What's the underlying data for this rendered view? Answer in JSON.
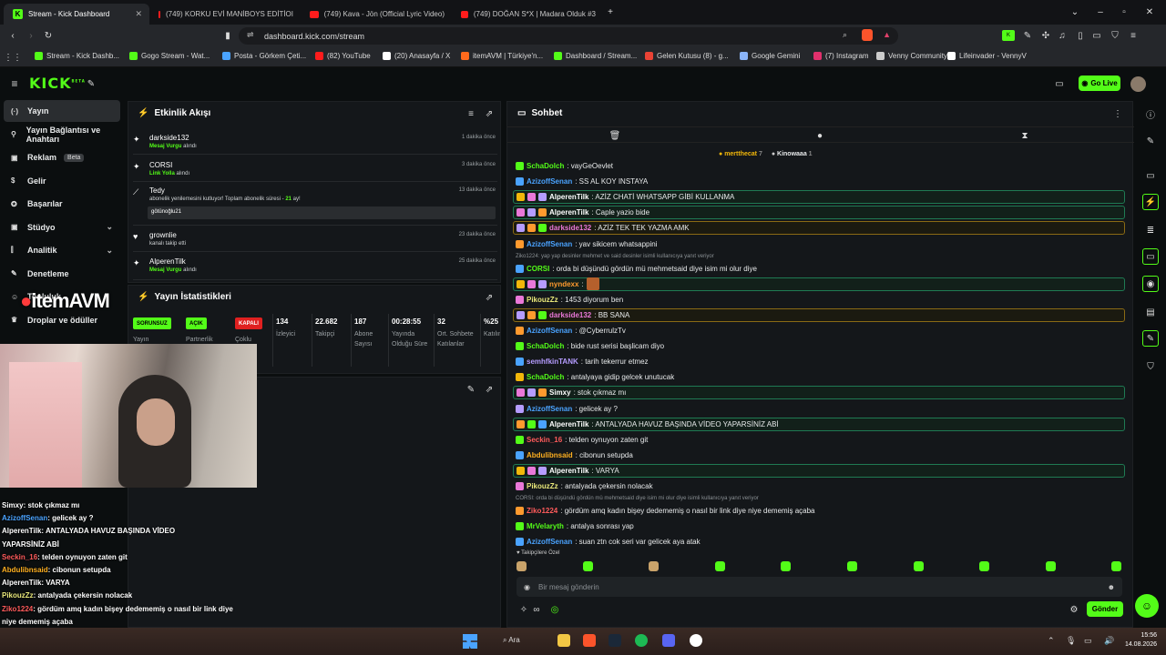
{
  "browser": {
    "tabs": [
      {
        "label": "Stream - Kick Dashboard",
        "active": true
      },
      {
        "label": "(749) KORKU EVİ MANİBOYS EDİTİOI"
      },
      {
        "label": "(749) Kava - Jön (Official Lyric Video)"
      },
      {
        "label": "(749) DOĞAN S*X | Madara Olduk #3"
      }
    ],
    "url": "dashboard.kick.com/stream",
    "bookmarks": [
      "Stream - Kick Dashb...",
      "Gogo Stream - Wat...",
      "Posta - Görkem Çeti...",
      "(82) YouTube",
      "(20) Anasayfa / X",
      "itemAVM | Türkiye'n...",
      "Dashboard / Stream...",
      "Gelen Kutusu (8) - g...",
      "Google Gemini",
      "(7) Instagram",
      "Venny Community",
      "Lifeinvader - VennyV"
    ]
  },
  "header": {
    "logo": "KICK",
    "logo_sup": "BETA",
    "go_live": "Go Live"
  },
  "sidebar": {
    "items": [
      {
        "label": "Yayın"
      },
      {
        "label": "Yayın Bağlantısı ve Anahtarı"
      },
      {
        "label": "Reklam",
        "badge": "Beta"
      },
      {
        "label": "Gelir"
      },
      {
        "label": "Başarılar"
      },
      {
        "label": "Stüdyo"
      },
      {
        "label": "Analitik"
      },
      {
        "label": "Denetleme"
      },
      {
        "label": "Topluluk"
      },
      {
        "label": "Droplar ve ödüller"
      }
    ]
  },
  "activity": {
    "title": "Etkinlik Akışı",
    "events": [
      {
        "name": "darkside132",
        "action": "Mesaj Vurgu",
        "suffix": "alındı",
        "time": "1 dakika önce"
      },
      {
        "name": "CORSI",
        "action": "Link Yolla",
        "suffix": "alındı",
        "time": "3 dakika önce"
      },
      {
        "name": "Tedy",
        "text": "abonelik yenilemesini kutluyor! Toplam abonelik süresi -",
        "months": "21",
        "months_suffix": "ay!",
        "message": "götünoğlu21",
        "time": "13 dakika önce"
      },
      {
        "name": "grownlie",
        "text": "kanalı takip etti",
        "time": "23 dakika önce"
      },
      {
        "name": "AlperenTilk",
        "action": "Mesaj Vurgu",
        "suffix": "alındı",
        "time": "25 dakika önce"
      }
    ]
  },
  "stats": {
    "title": "Yayın İstatistikleri",
    "pills": [
      "SORUNSUZ",
      "AÇIK",
      "KAPALI"
    ],
    "pill_labels": [
      "Yayın",
      "Partnerlik",
      "Çoklu"
    ],
    "items": [
      {
        "value": "134",
        "label": "İzleyici"
      },
      {
        "value": "22.682",
        "label": "Takipçi"
      },
      {
        "value": "187",
        "label": "Abone Sayısı"
      },
      {
        "value": "00:28:55",
        "label": "Yayında Olduğu Süre"
      },
      {
        "value": "32",
        "label": "Ort. Sohbete Katılanlar"
      },
      {
        "value": "%25",
        "label": "Katılım"
      }
    ]
  },
  "webcam_overlay": {
    "brand": "itemAVM",
    "lines": [
      {
        "user": "Simxy",
        "text": ": stok çıkmaz mı",
        "color": "#ffffff"
      },
      {
        "user": "AzizoffSenan",
        "text": ": gelicek ay ?",
        "color": "#4aa3ff"
      },
      {
        "user": "AlperenTilk",
        "text": ": ANTALYADA HAVUZ BAŞINDA VİDEO",
        "color": "#ffffff"
      },
      {
        "user": "",
        "text": "YAPARSİNİZ ABİ",
        "color": "#ffffff"
      },
      {
        "user": "Seckin_16",
        "text": ": telden oynuyon zaten git",
        "color": "#ff5b5b"
      },
      {
        "user": "Abdulibnsaid",
        "text": ": cibonun setupda",
        "color": "#ffb020"
      },
      {
        "user": "AlperenTilk",
        "text": ": VARYA",
        "color": "#ffffff"
      },
      {
        "user": "PikouzZz",
        "text": ": antalyada çekersin nolacak",
        "color": "#e9e87a"
      },
      {
        "user": "Ziko1224",
        "text": ": gördüm amq kadın bişey dedememiş o nasıl bir link diye",
        "color": "#ff5b5b"
      },
      {
        "user": "",
        "text": "niye dememiş açaba",
        "color": "#ffffff"
      },
      {
        "user": "MrVelaryth",
        "text": ": antalya sonrası yap",
        "color": "#53fc18"
      },
      {
        "user": "AzizoffSenan",
        "text": ": suan ztn cok seri var gelicek aya atak",
        "color": "#4aa3ff"
      }
    ]
  },
  "chat": {
    "title": "Sohbet",
    "pinned_users": [
      {
        "name": "mertthecat",
        "count": "7"
      },
      {
        "name": "Kinowaaa",
        "count": "1"
      }
    ],
    "messages": [
      {
        "user": "SchaDolch",
        "text": ": vayGeOevlet",
        "color": "#53fc18"
      },
      {
        "user": "AzizoffSenan",
        "text": ": SS AL KOY INSTAYA",
        "color": "#4aa3ff"
      },
      {
        "user": "AlperenTilk",
        "text": ": AZİZ CHATİ WHATSAPP GİBİ KULLANMA",
        "color": "#ffffff",
        "hl": true
      },
      {
        "user": "AlperenTilk",
        "text": ": Caple yazio bide",
        "color": "#ffffff",
        "hl": true
      },
      {
        "user": "darkside132",
        "text": ": AZİZ TEK TEK YAZMA AMK",
        "color": "#e978d8",
        "gold": true
      },
      {
        "user": "AzizoffSenan",
        "text": ": yav sikicem whatsappini",
        "color": "#4aa3ff"
      },
      {
        "reply": "Ziko1224: yap yap desinler mehmet ve said desinler isimli kullanıcıya yanıt veriyor"
      },
      {
        "user": "CORSI",
        "text": ": orda bi düşündü gördün mü mehmetsaid diye isim mi olur diye",
        "color": "#53fc18"
      },
      {
        "user": "nyndexx",
        "text": ":",
        "color": "#ff9a2e",
        "hl": true
      },
      {
        "user": "PikouzZz",
        "text": ": 1453 diyorum ben",
        "color": "#e9e87a"
      },
      {
        "user": "darkside132",
        "text": ": BB SANA",
        "color": "#e978d8",
        "gold": true
      },
      {
        "user": "AzizoffSenan",
        "text": ": @CyberrulzTv",
        "color": "#4aa3ff"
      },
      {
        "user": "SchaDolch",
        "text": ": bide rust serisi başlicam diyo",
        "color": "#53fc18"
      },
      {
        "user": "semhfkinTANK",
        "text": ": tarih tekerrur etmez",
        "color": "#b59cff"
      },
      {
        "user": "SchaDolch",
        "text": ": antalyaya gidip gelcek unutucak",
        "color": "#53fc18"
      },
      {
        "user": "Simxy",
        "text": ": stok çıkmaz mı",
        "color": "#ffffff",
        "hl": true
      },
      {
        "user": "AzizoffSenan",
        "text": ": gelicek ay ?",
        "color": "#4aa3ff"
      },
      {
        "user": "AlperenTilk",
        "text": ": ANTALYADA HAVUZ BAŞINDA VİDEO YAPARSİNİZ ABİ",
        "color": "#ffffff",
        "hl": true
      },
      {
        "user": "Seckin_16",
        "text": ": telden oynuyon zaten git",
        "color": "#ff5b5b"
      },
      {
        "user": "Abdulibnsaid",
        "text": ": cibonun setupda",
        "color": "#ffb020"
      },
      {
        "user": "AlperenTilk",
        "text": ": VARYA",
        "color": "#ffffff",
        "hl": true
      },
      {
        "user": "PikouzZz",
        "text": ": antalyada çekersin nolacak",
        "color": "#e9e87a"
      },
      {
        "reply": "CORSI: orda bi düşündü gördün mü mehmetsaid diye isim mi olur diye isimli kullanıcıya yanıt veriyor"
      },
      {
        "user": "Ziko1224",
        "text": ": gördüm amq kadın bişey dedememiş o nasıl bir link diye niye dememiş açaba",
        "color": "#ff5b5b"
      },
      {
        "user": "MrVelaryth",
        "text": ": antalya sonrası yap",
        "color": "#53fc18"
      },
      {
        "user": "AzizoffSenan",
        "text": ": suan ztn cok seri var gelicek aya atak",
        "color": "#4aa3ff"
      }
    ],
    "follower_special": "Takipçilere Özel",
    "input_placeholder": "Bir mesaj gönderin",
    "send_label": "Gönder"
  },
  "taskbar": {
    "search": "Ara",
    "time": "15:56",
    "date": "14.08.2026"
  }
}
